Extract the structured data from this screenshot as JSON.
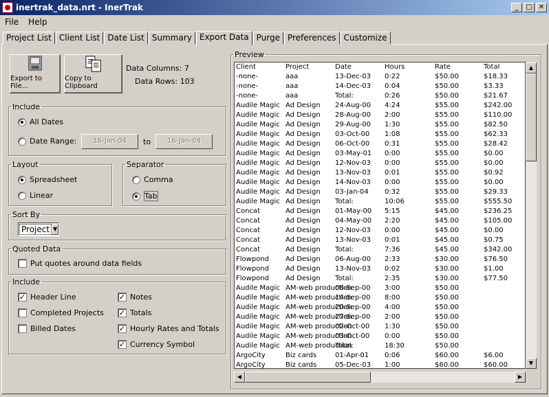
{
  "window": {
    "title": "inertrak_data.nrt - InerTrak",
    "min": "_",
    "max": "□",
    "close": "✕"
  },
  "menu": [
    "File",
    "Help"
  ],
  "tabs": [
    "Project List",
    "Client List",
    "Date List",
    "Summary",
    "Export Data",
    "Purge",
    "Preferences",
    "Customize"
  ],
  "active_tab": "Export Data",
  "actions": {
    "export_label": "Export to File...",
    "clipboard_label": "Copy to Clipboard"
  },
  "stats": {
    "columns_label": "Data Columns:",
    "columns_value": "7",
    "rows_label": "Data Rows:",
    "rows_value": "103"
  },
  "include_dates": {
    "title": "Include",
    "all_dates": "All Dates",
    "date_range": "Date Range:",
    "from": "16-Jan-04",
    "to_label": "to",
    "to": "16-Jan-04",
    "selected": "All Dates"
  },
  "layout": {
    "title": "Layout",
    "spreadsheet": "Spreadsheet",
    "linear": "Linear",
    "selected": "Spreadsheet"
  },
  "separator": {
    "title": "Separator",
    "comma": "Comma",
    "tab": "Tab",
    "selected": "Tab"
  },
  "sort_by": {
    "title": "Sort By",
    "value": "Project"
  },
  "quoted": {
    "title": "Quoted Data",
    "label": "Put quotes around data fields",
    "checked": false
  },
  "include_fields": {
    "title": "Include",
    "header_line": "Header Line",
    "completed_projects": "Completed Projects",
    "billed_dates": "Billed Dates",
    "notes": "Notes",
    "totals": "Totals",
    "hourly_rates": "Hourly Rates and Totals",
    "currency": "Currency Symbol"
  },
  "preview": {
    "title": "Preview",
    "columns": [
      "Client",
      "Project",
      "Date",
      "Hours",
      "Rate",
      "Total"
    ],
    "rows": [
      [
        "-none-",
        "aaa",
        "13-Dec-03",
        "0:22",
        "$50.00",
        "$18.33"
      ],
      [
        "-none-",
        "aaa",
        "14-Dec-03",
        "0:04",
        "$50.00",
        "$3.33"
      ],
      [
        "-none-",
        "aaa",
        "Total:",
        "0:26",
        "$50.00",
        "$21.67"
      ],
      [
        "Audile Magic",
        "Ad Design",
        "24-Aug-00",
        "4:24",
        "$55.00",
        "$242.00"
      ],
      [
        "Audile Magic",
        "Ad Design",
        "28-Aug-00",
        "2:00",
        "$55.00",
        "$110.00"
      ],
      [
        "Audile Magic",
        "Ad Design",
        "29-Aug-00",
        "1:30",
        "$55.00",
        "$82.50"
      ],
      [
        "Audile Magic",
        "Ad Design",
        "03-Oct-00",
        "1:08",
        "$55.00",
        "$62.33"
      ],
      [
        "Audile Magic",
        "Ad Design",
        "06-Oct-00",
        "0:31",
        "$55.00",
        "$28.42"
      ],
      [
        "Audile Magic",
        "Ad Design",
        "03-May-01",
        "0:00",
        "$55.00",
        "$0.00"
      ],
      [
        "Audile Magic",
        "Ad Design",
        "12-Nov-03",
        "0:00",
        "$55.00",
        "$0.00"
      ],
      [
        "Audile Magic",
        "Ad Design",
        "13-Nov-03",
        "0:01",
        "$55.00",
        "$0.92"
      ],
      [
        "Audile Magic",
        "Ad Design",
        "14-Nov-03",
        "0:00",
        "$55.00",
        "$0.00"
      ],
      [
        "Audile Magic",
        "Ad Design",
        "03-Jan-04",
        "0:32",
        "$55.00",
        "$29.33"
      ],
      [
        "Audile Magic",
        "Ad Design",
        "Total:",
        "10:06",
        "$55.00",
        "$555.50"
      ],
      [
        "Concat",
        "Ad Design",
        "01-May-00",
        "5:15",
        "$45.00",
        "$236.25"
      ],
      [
        "Concat",
        "Ad Design",
        "04-May-00",
        "2:20",
        "$45.00",
        "$105.00"
      ],
      [
        "Concat",
        "Ad Design",
        "12-Nov-03",
        "0:00",
        "$45.00",
        "$0.00"
      ],
      [
        "Concat",
        "Ad Design",
        "13-Nov-03",
        "0:01",
        "$45.00",
        "$0.75"
      ],
      [
        "Concat",
        "Ad Design",
        "Total:",
        "7:36",
        "$45.00",
        "$342.00"
      ],
      [
        "Flowpond",
        "Ad Design",
        "06-Aug-00",
        "2:33",
        "$30.00",
        "$76.50"
      ],
      [
        "Flowpond",
        "Ad Design",
        "13-Nov-03",
        "0:02",
        "$30.00",
        "$1.00"
      ],
      [
        "Flowpond",
        "Ad Design",
        "Total:",
        "2:35",
        "$30.00",
        "$77.50"
      ],
      [
        "Audile Magic",
        "AM-web production",
        "08-Sep-00",
        "3:00",
        "$50.00",
        ""
      ],
      [
        "Audile Magic",
        "AM-web production",
        "14-Sep-00",
        "8:00",
        "$50.00",
        ""
      ],
      [
        "Audile Magic",
        "AM-web production",
        "20-Sep-00",
        "4:00",
        "$50.00",
        ""
      ],
      [
        "Audile Magic",
        "AM-web production",
        "27-Sep-00",
        "2:00",
        "$50.00",
        ""
      ],
      [
        "Audile Magic",
        "AM-web production",
        "02-Oct-00",
        "1:30",
        "$50.00",
        ""
      ],
      [
        "Audile Magic",
        "AM-web production",
        "03-Oct-00",
        "0:00",
        "$50.00",
        ""
      ],
      [
        "Audile Magic",
        "AM-web production",
        "Total:",
        "18:30",
        "$50.00",
        ""
      ],
      [
        "ArgoCity",
        "Biz cards",
        "01-Apr-01",
        "0:06",
        "$60.00",
        "$6.00"
      ],
      [
        "ArgoCity",
        "Biz cards",
        "05-Dec-03",
        "1:00",
        "$60.00",
        "$60.00"
      ]
    ]
  }
}
